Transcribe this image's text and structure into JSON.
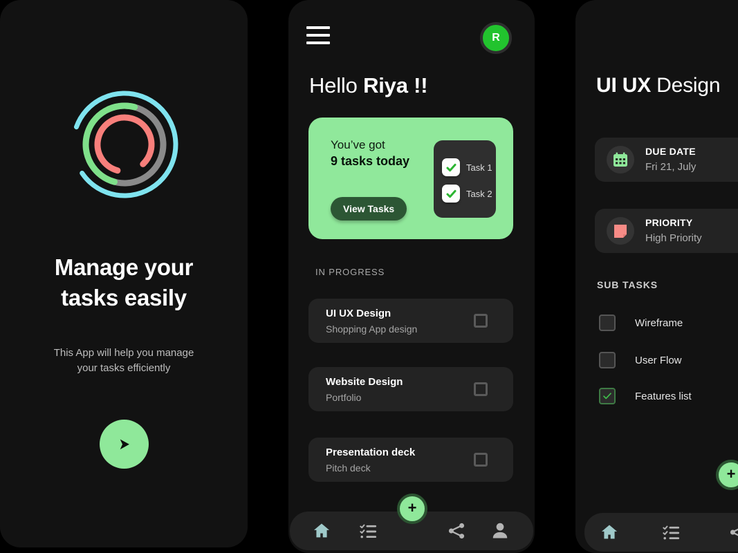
{
  "app": {
    "accent_green": "#8fe89a",
    "card_green": "#90e89b",
    "dark_bg": "#121212",
    "card_bg": "#232323",
    "avatar_green": "#22c32e",
    "priority_salmon": "#f78b86",
    "logo_cyan": "#7fe3ef",
    "logo_gray": "#8a8a8a",
    "logo_green": "#7fe08a",
    "logo_red": "#f87f7b"
  },
  "onboarding": {
    "logo_name": "app-rings-logo",
    "title": "Manage your tasks easily",
    "title_line1": "Manage your",
    "title_line2": "tasks easily",
    "subtitle_line1": "This App will help you manage",
    "subtitle_line2": "your tasks efficiently",
    "next_button_icon": "play-arrow-icon",
    "next_button_glyph": "➤"
  },
  "home": {
    "menu_icon": "hamburger-menu-icon",
    "avatar_initial": "R",
    "greeting_prefix": "Hello ",
    "greeting_name": "Riya !!",
    "summary_card": {
      "line1": "You’ve got",
      "line2": "9 tasks today",
      "button_label": "View Tasks",
      "tasks": [
        {
          "label": "Task 1",
          "checked": true
        },
        {
          "label": "Task 2",
          "checked": true
        }
      ]
    },
    "section_label": "IN PROGRESS",
    "tasks": [
      {
        "title": "UI UX Design",
        "subtitle": "Shopping App design",
        "checked": false
      },
      {
        "title": "Website Design",
        "subtitle": "Portfolio",
        "checked": false
      },
      {
        "title": "Presentation deck",
        "subtitle": "Pitch deck",
        "checked": false
      }
    ],
    "fab_icon": "plus-icon",
    "fab_glyph": "+",
    "nav": [
      {
        "name": "home-icon",
        "active": true
      },
      {
        "name": "checklist-icon",
        "active": false
      },
      {
        "name": "share-icon",
        "active": false
      },
      {
        "name": "person-icon",
        "active": false
      }
    ]
  },
  "detail": {
    "title_bold": "UI UX",
    "title_regular": " Design",
    "meta": [
      {
        "icon": "calendar-icon",
        "label": "DUE DATE",
        "value": "Fri 21, July"
      },
      {
        "icon": "priority-note-icon",
        "label": "PRIORITY",
        "value": "High Priority"
      }
    ],
    "subtasks_label": "SUB TASKS",
    "subtasks": [
      {
        "label": "Wireframe",
        "checked": false
      },
      {
        "label": "User Flow",
        "checked": false
      },
      {
        "label": "Features list",
        "checked": true
      }
    ],
    "fab_icon": "plus-icon",
    "fab_glyph": "+",
    "nav": [
      {
        "name": "home-icon",
        "active": true
      },
      {
        "name": "checklist-icon",
        "active": false
      },
      {
        "name": "share-icon",
        "active": false
      }
    ]
  }
}
